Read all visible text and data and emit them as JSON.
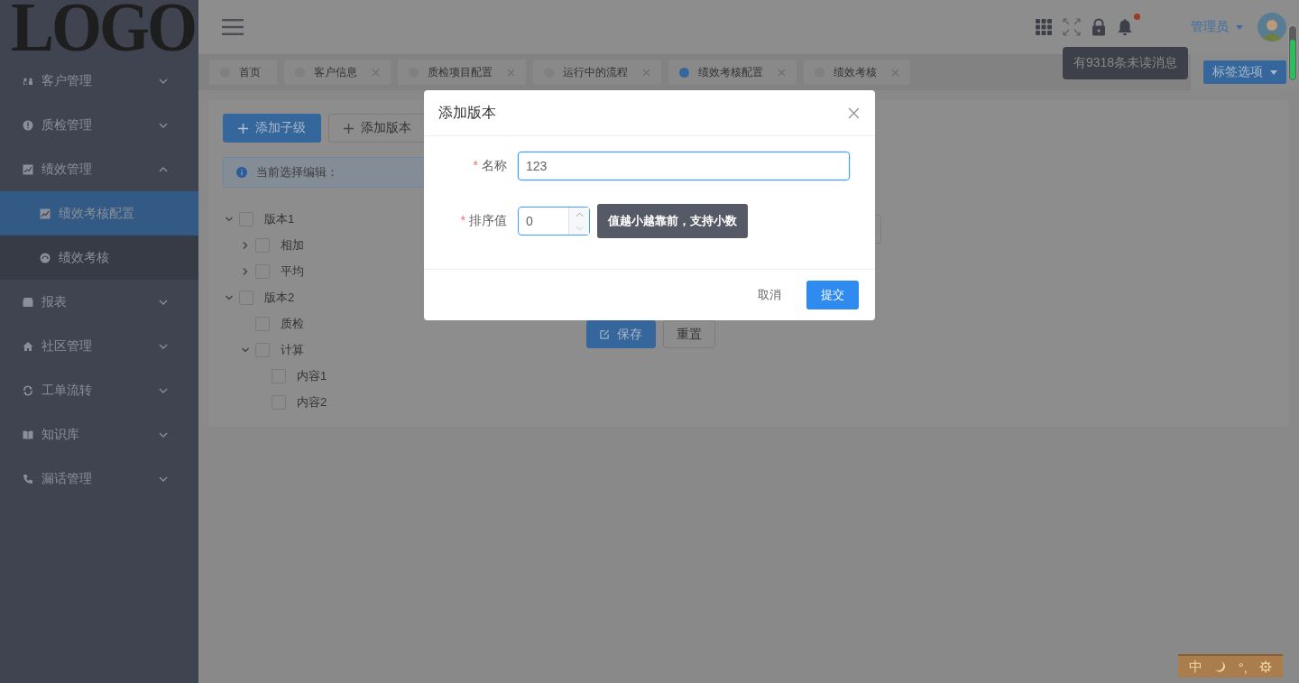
{
  "sidebar": {
    "logo": "LOGO",
    "items": [
      {
        "label": "客户管理",
        "kind": "users",
        "expanded": false,
        "selected": false
      },
      {
        "label": "质检管理",
        "kind": "alert",
        "expanded": false,
        "selected": false
      },
      {
        "label": "绩效管理",
        "kind": "chart",
        "expanded": true,
        "selected": false,
        "children": [
          {
            "label": "绩效考核配置",
            "kind": "chart",
            "selected": true
          },
          {
            "label": "绩效考核",
            "kind": "dial",
            "selected": false
          }
        ]
      },
      {
        "label": "报表",
        "kind": "box",
        "expanded": false,
        "selected": false
      },
      {
        "label": "社区管理",
        "kind": "home",
        "expanded": false,
        "selected": false
      },
      {
        "label": "工单流转",
        "kind": "cycle",
        "expanded": false,
        "selected": false
      },
      {
        "label": "知识库",
        "kind": "book",
        "expanded": false,
        "selected": false
      },
      {
        "label": "漏话管理",
        "kind": "phone",
        "expanded": false,
        "selected": false
      }
    ]
  },
  "header": {
    "user": "管理员",
    "notifications_tooltip": "有9318条未读消息",
    "unread": true
  },
  "tabs": [
    {
      "label": "首页",
      "selected": false,
      "closable": false
    },
    {
      "label": "客户信息",
      "selected": false,
      "closable": true
    },
    {
      "label": "质检项目配置",
      "selected": false,
      "closable": true
    },
    {
      "label": "运行中的流程",
      "selected": false,
      "closable": true
    },
    {
      "label": "绩效考核配置",
      "selected": true,
      "closable": true
    },
    {
      "label": "绩效考核",
      "selected": false,
      "closable": true
    }
  ],
  "tab_options": "标签选项",
  "toolbar": [
    {
      "label": "添加子级",
      "primary": true
    },
    {
      "label": "添加版本",
      "primary": false
    }
  ],
  "alert": "当前选择编辑：",
  "tree": [
    {
      "label": "版本1",
      "checked": false,
      "expanded": true,
      "children": [
        {
          "label": "相加",
          "checked": false,
          "expanded": false
        },
        {
          "label": "平均",
          "checked": false,
          "expanded": false
        }
      ]
    },
    {
      "label": "版本2",
      "checked": false,
      "expanded": true,
      "children": [
        {
          "label": "质检",
          "checked": false
        },
        {
          "label": "计算",
          "checked": false,
          "expanded": true,
          "children": [
            {
              "label": "内容1",
              "checked": false
            },
            {
              "label": "内容2",
              "checked": false
            }
          ]
        }
      ]
    }
  ],
  "form_buttons": [
    {
      "label": "保存",
      "primary": true
    },
    {
      "label": "重置",
      "primary": false
    }
  ],
  "dialog": {
    "title": "添加版本",
    "fields": [
      {
        "kind": "text",
        "label": "名称",
        "required_mark": "*",
        "value": "123"
      },
      {
        "kind": "number",
        "label": "排序值",
        "required_mark": "*",
        "value": "0",
        "hint": "值越小越靠前，支持小数"
      }
    ],
    "buttons": [
      {
        "label": "取消",
        "primary": false
      },
      {
        "label": "提交",
        "primary": true
      }
    ]
  },
  "ime": {
    "mode": "中",
    "punctuation": "°,"
  }
}
